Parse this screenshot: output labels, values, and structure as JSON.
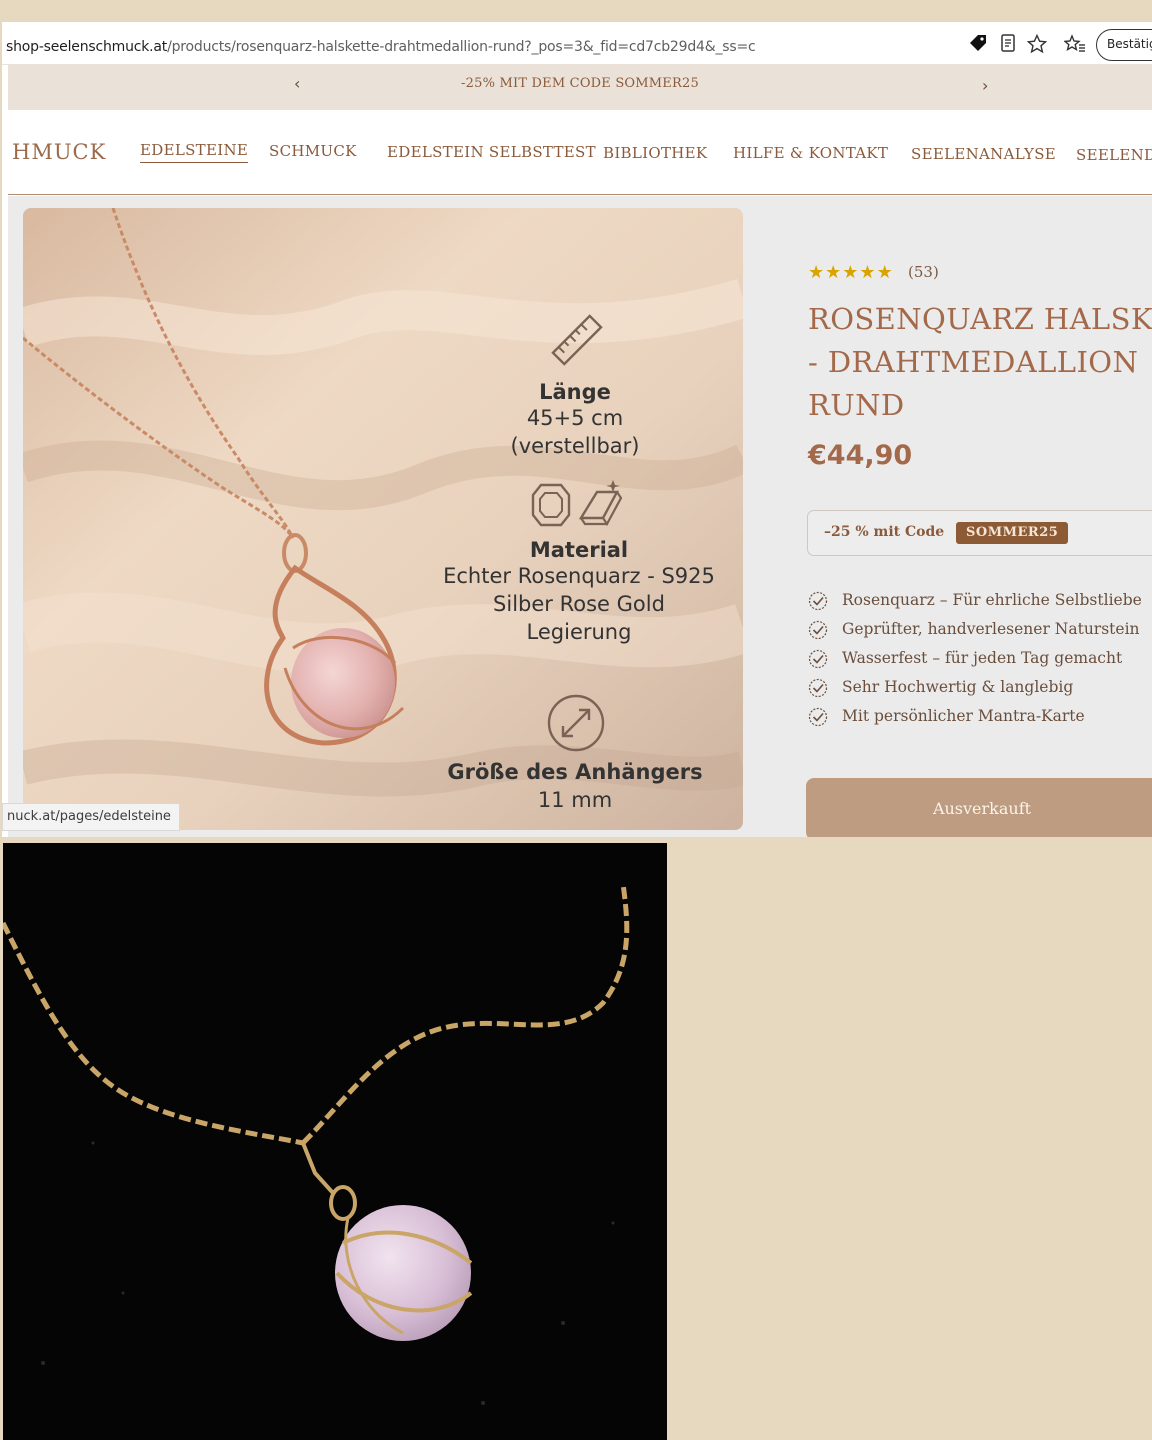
{
  "browser": {
    "url_domain": "shop-seelenschmuck.at",
    "url_path": "/products/rosenquarz-halskette-drahtmedallion-rund?_pos=3&_fid=cd7cb29d4&_ss=c",
    "confirm_label": "Bestätig",
    "status_url": "nuck.at/pages/edelsteine"
  },
  "promo": {
    "text": "-25% MIT DEM CODE SOMMER25",
    "prev": "‹",
    "next": "›"
  },
  "nav": {
    "brand": "HMUCK",
    "items": [
      "EDELSTEINE",
      "SCHMUCK",
      "EDELSTEIN SELBSTTEST",
      "BIBLIOTHEK",
      "HILFE & KONTAKT",
      "SEELENANALYSE",
      "SEELENDU"
    ],
    "active_index": 0
  },
  "product_image": {
    "length_title": "Länge",
    "length_value": "45+5 cm",
    "length_note": "(verstellbar)",
    "material_title": "Material",
    "material_lines": [
      "Echter Rosenquarz - S925",
      "Silber Rose Gold",
      "Legierung"
    ],
    "size_title": "Größe des Anhängers",
    "size_value": "11 mm",
    "icons": [
      "ruler-icon",
      "gem-icon",
      "gold-bar-icon",
      "resize-arrows-icon"
    ]
  },
  "product": {
    "rating_stars": 5,
    "rating_count": "(53)",
    "title_lines": [
      "ROSENQUARZ HALSKE",
      "- DRAHTMEDALLION",
      "RUND"
    ],
    "price": "€44,90",
    "coupon_text": "–25 % mit Code",
    "coupon_code": "SOMMER25",
    "benefits": [
      "Rosenquarz – Für ehrliche Selbstliebe",
      "Geprüfter, handverlesener Naturstein",
      "Wasserfest – für jeden Tag gemacht",
      "Sehr Hochwertig & langlebig",
      "Mit persönlicher Mantra-Karte"
    ],
    "buy_label": "Ausverkauft"
  },
  "colors": {
    "page_background": "#e6d9c0",
    "accent_brown": "#a3694a",
    "button": "#bd9c82",
    "coupon_badge": "#8d5a36"
  }
}
